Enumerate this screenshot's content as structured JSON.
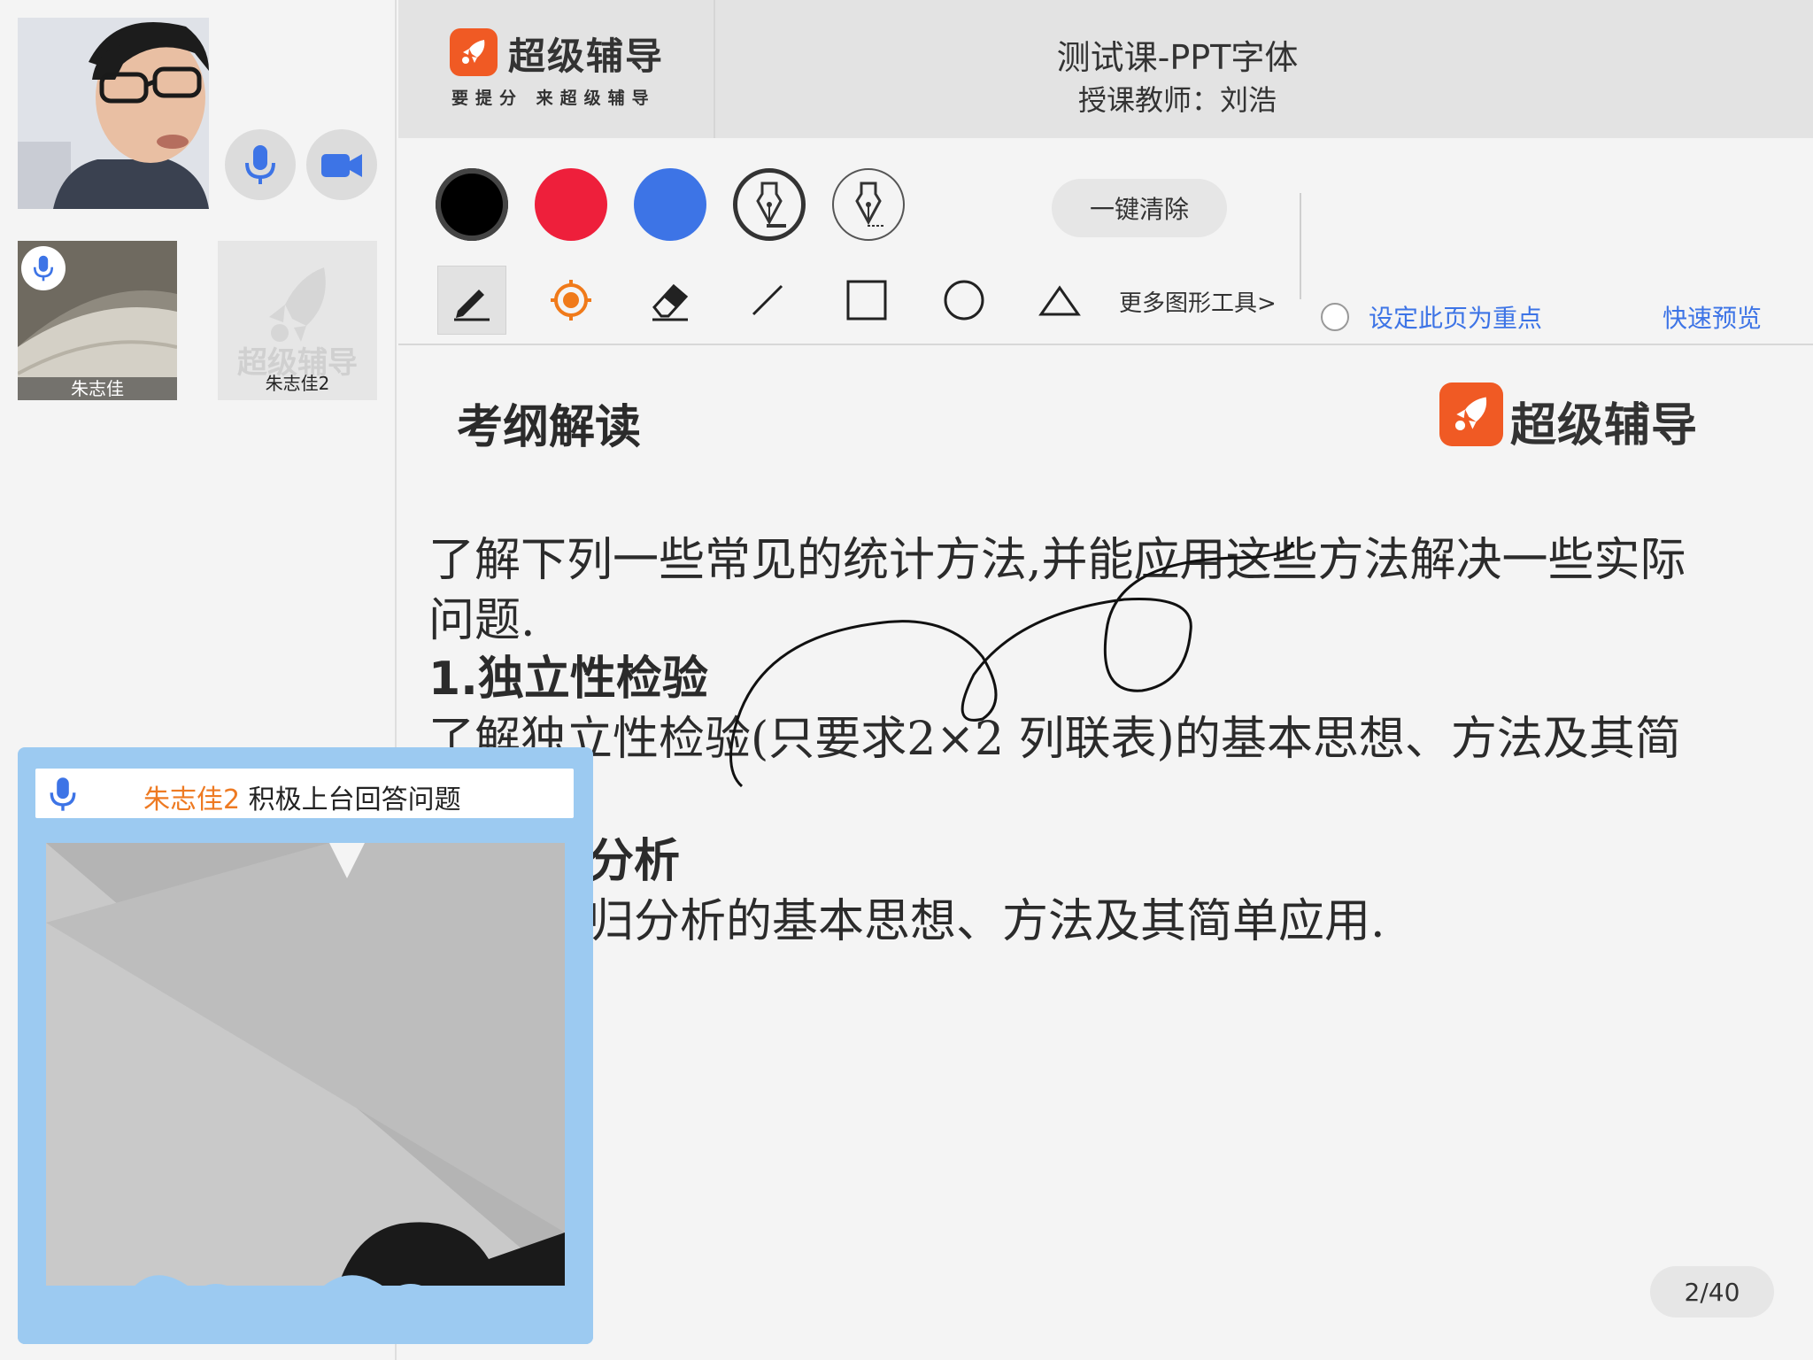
{
  "header": {
    "brand_name": "超级辅导",
    "brand_slogan": "要提分 来超级辅导",
    "course_title": "测试课-PPT字体",
    "teacher_line": "授课教师：刘浩"
  },
  "participants": {
    "student1_name": "朱志佳",
    "student2_name": "朱志佳2",
    "student2_placeholder": "超级辅导"
  },
  "toolbar": {
    "colors": [
      "#000000",
      "#ee1f3b",
      "#3d74e6"
    ],
    "clear_label": "一键清除",
    "more_tools_label": "更多图形工具>",
    "mark_page_label": "设定此页为重点",
    "quick_preview_label": "快速预览",
    "tools": [
      "pencil-icon",
      "laser-pointer-icon",
      "eraser-icon",
      "line-icon",
      "rectangle-icon",
      "circle-icon",
      "triangle-icon"
    ]
  },
  "slide": {
    "heading": "考纲解读",
    "logo_text": "超级辅导",
    "line1": "了解下列一些常见的统计方法,并能应用这些方法解决一些实际",
    "line2": "问题.",
    "line3": "1.独立性检验",
    "line4": "了解独立性检验(只要求2×2 列联表)的基本思想、方法及其简",
    "line5": "分析",
    "line6": "归分析的基本思想、方法及其简单应用."
  },
  "pagination": {
    "label": "2/40",
    "current": 2,
    "total": 40
  },
  "stage": {
    "student_name": "朱志佳2",
    "message": " 积极上台回答问题"
  }
}
